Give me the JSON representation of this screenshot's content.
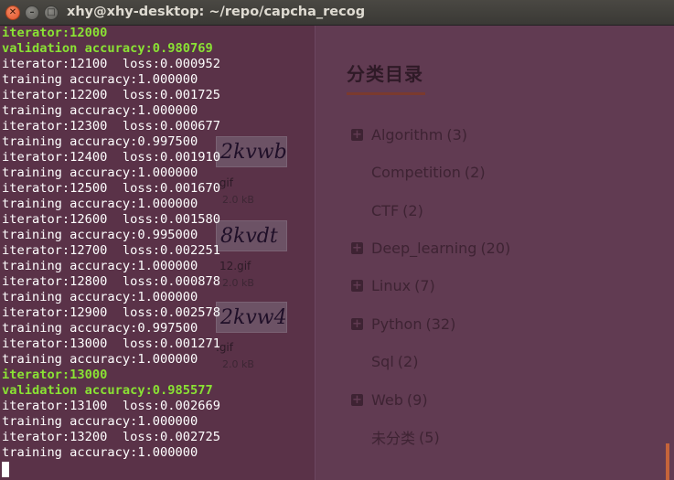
{
  "window": {
    "title": "xhy@xhy-desktop: ~/repo/capcha_recog",
    "buttons": [
      "close",
      "minimize",
      "maximize"
    ]
  },
  "terminal": {
    "lines": [
      {
        "text": "iterator:12000",
        "highlight": true
      },
      {
        "text": "validation accuracy:0.980769",
        "highlight": true
      },
      {
        "text": "iterator:12100  loss:0.000952",
        "highlight": false
      },
      {
        "text": "training accuracy:1.000000",
        "highlight": false
      },
      {
        "text": "iterator:12200  loss:0.001725",
        "highlight": false
      },
      {
        "text": "training accuracy:1.000000",
        "highlight": false
      },
      {
        "text": "iterator:12300  loss:0.000677",
        "highlight": false
      },
      {
        "text": "training accuracy:0.997500",
        "highlight": false
      },
      {
        "text": "iterator:12400  loss:0.001910",
        "highlight": false
      },
      {
        "text": "training accuracy:1.000000",
        "highlight": false
      },
      {
        "text": "iterator:12500  loss:0.001670",
        "highlight": false
      },
      {
        "text": "training accuracy:1.000000",
        "highlight": false
      },
      {
        "text": "iterator:12600  loss:0.001580",
        "highlight": false
      },
      {
        "text": "training accuracy:0.995000",
        "highlight": false
      },
      {
        "text": "iterator:12700  loss:0.002251",
        "highlight": false
      },
      {
        "text": "training accuracy:1.000000",
        "highlight": false
      },
      {
        "text": "iterator:12800  loss:0.000878",
        "highlight": false
      },
      {
        "text": "training accuracy:1.000000",
        "highlight": false
      },
      {
        "text": "iterator:12900  loss:0.002578",
        "highlight": false
      },
      {
        "text": "training accuracy:0.997500",
        "highlight": false
      },
      {
        "text": "iterator:13000  loss:0.001271",
        "highlight": false
      },
      {
        "text": "training accuracy:1.000000",
        "highlight": false
      },
      {
        "text": "iterator:13000",
        "highlight": true
      },
      {
        "text": "validation accuracy:0.985577",
        "highlight": true
      },
      {
        "text": "iterator:13100  loss:0.002669",
        "highlight": false
      },
      {
        "text": "training accuracy:1.000000",
        "highlight": false
      },
      {
        "text": "iterator:13200  loss:0.002725",
        "highlight": false
      },
      {
        "text": "training accuracy:1.000000",
        "highlight": false
      }
    ]
  },
  "background_page": {
    "category_heading": "分类目录",
    "categories": [
      {
        "name": "Algorithm",
        "count": "(3)",
        "expandable": true
      },
      {
        "name": "Competition",
        "count": "(2)",
        "expandable": false
      },
      {
        "name": "CTF",
        "count": "(2)",
        "expandable": false
      },
      {
        "name": "Deep_learning",
        "count": "(20)",
        "expandable": true
      },
      {
        "name": "Linux",
        "count": "(7)",
        "expandable": true
      },
      {
        "name": "Python",
        "count": "(32)",
        "expandable": true
      },
      {
        "name": "Sql",
        "count": "(2)",
        "expandable": false
      },
      {
        "name": "Web",
        "count": "(9)",
        "expandable": true
      },
      {
        "name": "未分类",
        "count": "(5)",
        "expandable": false
      }
    ],
    "thumbnails": [
      {
        "captcha": "2kvwb1",
        "name": ".gif",
        "size": "2.0 kB"
      },
      {
        "captcha": "8kvdt",
        "name": "12.gif",
        "size": "2.0 kB"
      },
      {
        "captcha": "2kvw4l",
        "name": ".gif",
        "size": "2.0 kB"
      }
    ]
  },
  "colors": {
    "terminal_text": "#ffffff",
    "terminal_highlight": "#8ae234",
    "close_button": "#e95420"
  }
}
